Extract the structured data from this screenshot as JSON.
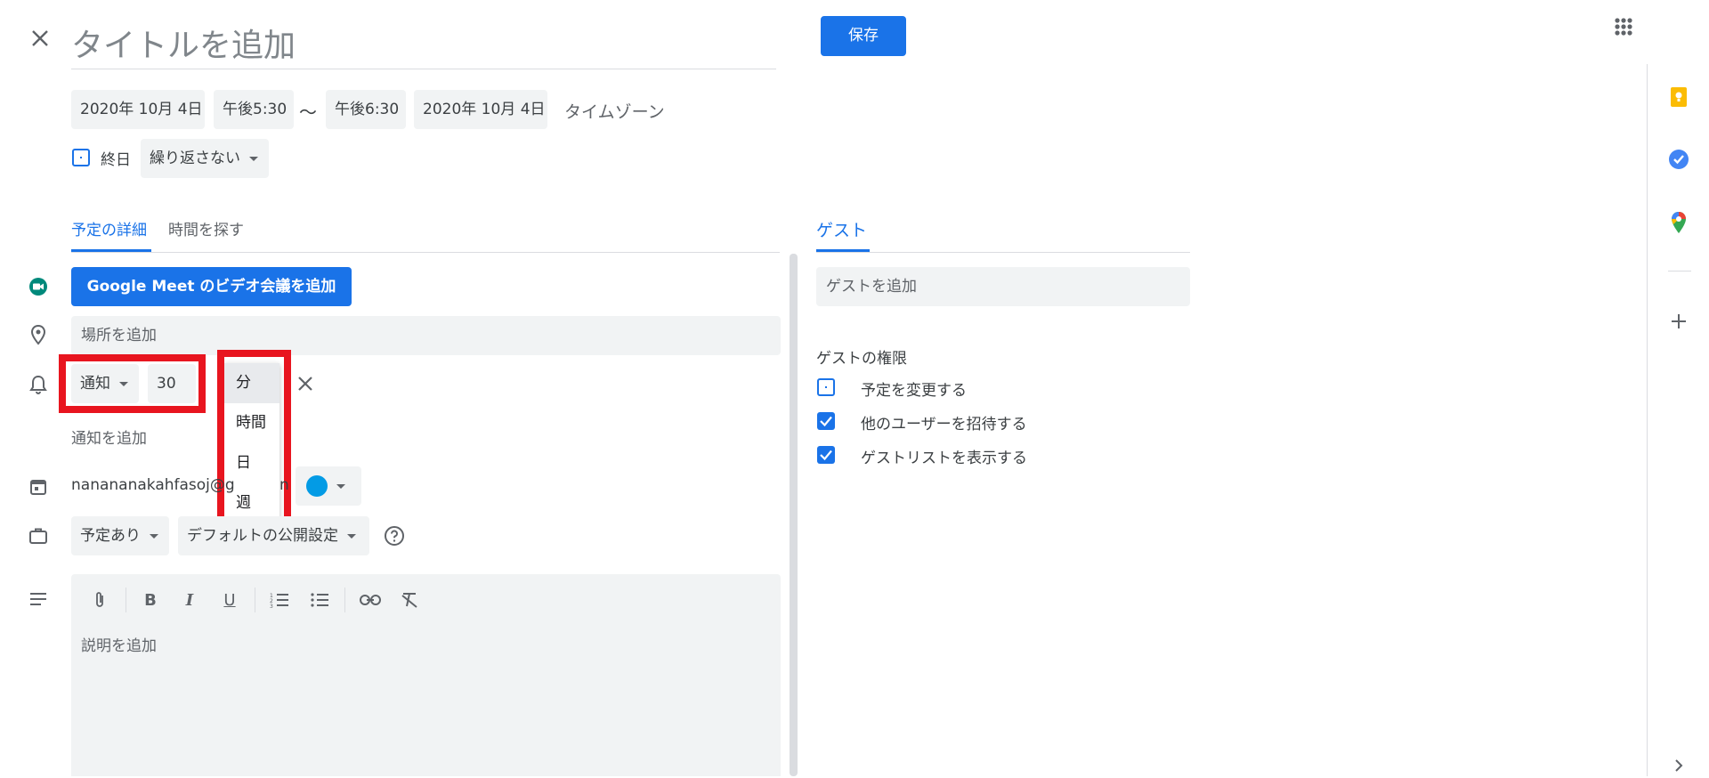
{
  "header": {
    "title_placeholder": "タイトルを追加",
    "save_label": "保存"
  },
  "datetime": {
    "start_date": "2020年 10月 4日",
    "start_time": "午後5:30",
    "separator": "〜",
    "end_time": "午後6:30",
    "end_date": "2020年 10月 4日",
    "timezone_label": "タイムゾーン",
    "all_day_label": "終日",
    "repeat_label": "繰り返さない"
  },
  "tabs": {
    "details": "予定の詳細",
    "find_time": "時間を探す",
    "guests": "ゲスト"
  },
  "details": {
    "meet_button": "Google Meet のビデオ会議を追加",
    "location_placeholder": "場所を追加",
    "notification_type": "通知",
    "notification_value": "30",
    "add_notification": "通知を追加",
    "calendar_email_start": "nanananakahfasoj@g",
    "calendar_email_end": "n",
    "availability": "予定あり",
    "visibility": "デフォルトの公開設定",
    "description_placeholder": "説明を追加"
  },
  "unit_menu": {
    "options": [
      "分",
      "時間",
      "日",
      "週"
    ],
    "selected": "分"
  },
  "guests": {
    "add_placeholder": "ゲストを追加",
    "permissions_title": "ゲストの権限",
    "permissions": [
      {
        "label": "予定を変更する",
        "checked": false
      },
      {
        "label": "他のユーザーを招待する",
        "checked": true
      },
      {
        "label": "ゲストリストを表示する",
        "checked": true
      }
    ]
  },
  "colors": {
    "accent": "#1a73e8",
    "calendar_color": "#039be5",
    "highlight": "#e8151f"
  },
  "icons": {
    "close": "close-icon",
    "apps": "apps-grid-icon",
    "keep": "keep-icon",
    "tasks": "tasks-icon",
    "maps": "maps-icon",
    "add": "plus-icon"
  }
}
